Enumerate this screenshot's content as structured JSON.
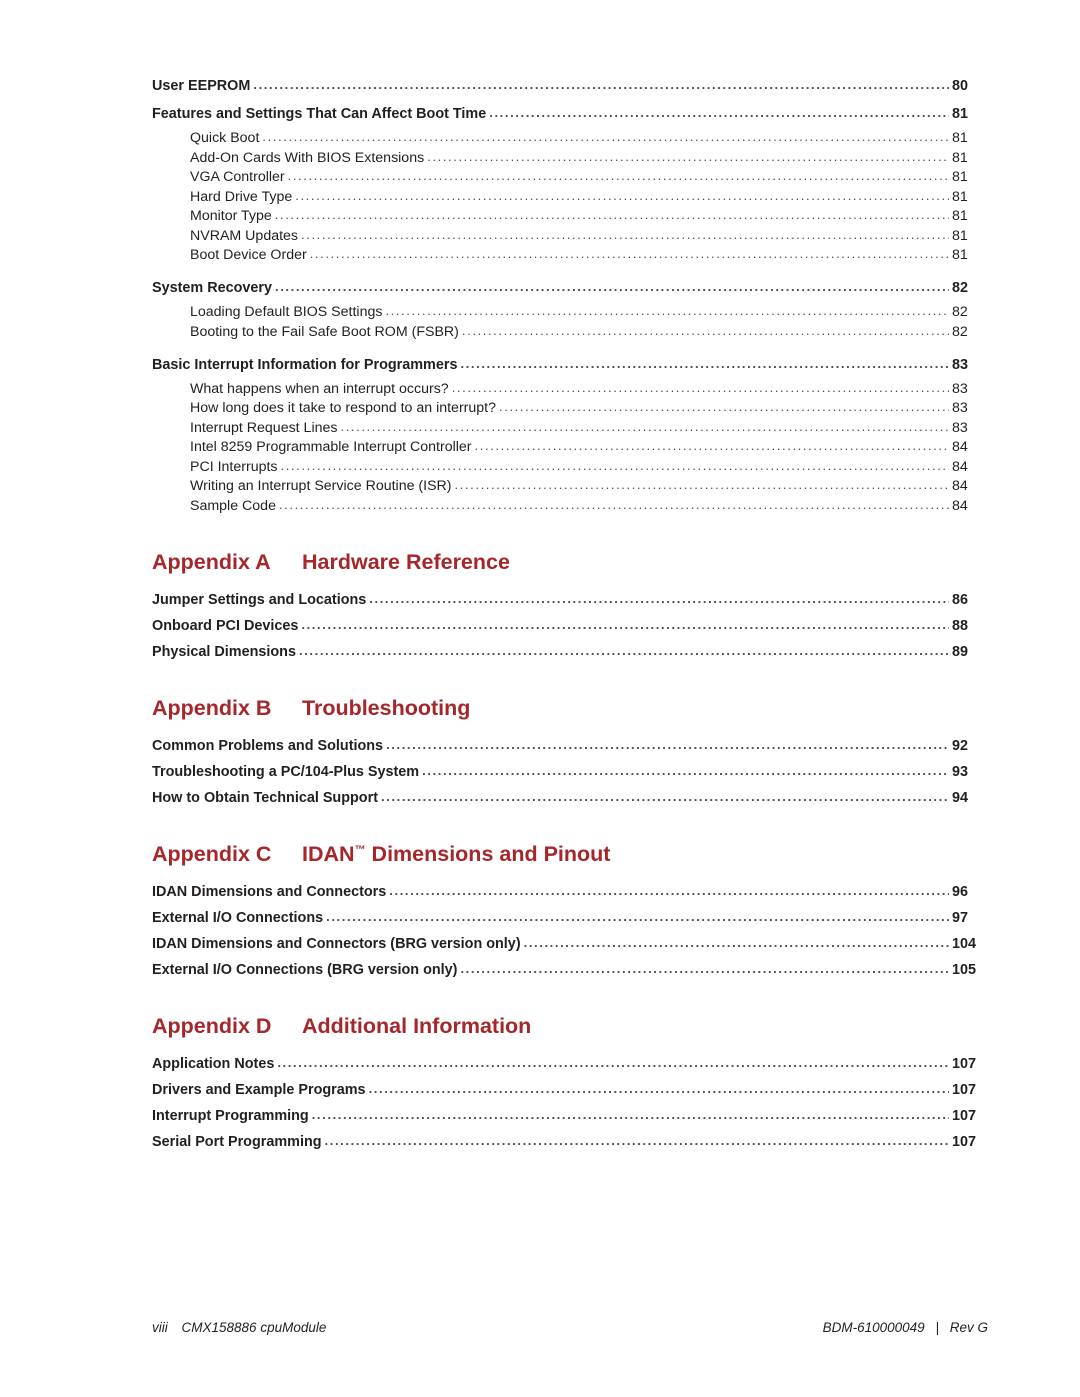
{
  "toc": {
    "sections": [
      {
        "type": "entries",
        "items": [
          {
            "level": 1,
            "label": "User EEPROM",
            "page": "80"
          },
          {
            "level": 1,
            "label": "Features and Settings That Can Affect Boot Time",
            "page": "81"
          },
          {
            "level": 2,
            "label": "Quick Boot",
            "page": "81"
          },
          {
            "level": 2,
            "label": "Add-On Cards With BIOS Extensions",
            "page": "81"
          },
          {
            "level": 2,
            "label": "VGA Controller",
            "page": "81"
          },
          {
            "level": 2,
            "label": "Hard Drive Type",
            "page": "81"
          },
          {
            "level": 2,
            "label": "Monitor Type",
            "page": "81"
          },
          {
            "level": 2,
            "label": "NVRAM Updates",
            "page": "81"
          },
          {
            "level": 2,
            "label": "Boot Device Order",
            "page": "81"
          },
          {
            "level": 1,
            "label": "System Recovery",
            "page": "82"
          },
          {
            "level": 2,
            "label": "Loading Default BIOS Settings",
            "page": "82"
          },
          {
            "level": 2,
            "label": "Booting to the Fail Safe Boot ROM (FSBR)",
            "page": "82"
          },
          {
            "level": 1,
            "label": "Basic Interrupt Information for Programmers",
            "page": "83"
          },
          {
            "level": 2,
            "label": "What happens when an interrupt occurs?",
            "page": "83"
          },
          {
            "level": 2,
            "label": "How long does it take to respond to an interrupt?",
            "page": "83"
          },
          {
            "level": 2,
            "label": "Interrupt Request Lines",
            "page": "83"
          },
          {
            "level": 2,
            "label": "Intel 8259 Programmable Interrupt Controller",
            "page": "84"
          },
          {
            "level": 2,
            "label": "PCI Interrupts",
            "page": "84"
          },
          {
            "level": 2,
            "label": "Writing an Interrupt Service Routine (ISR)",
            "page": "84"
          },
          {
            "level": 2,
            "label": "Sample Code",
            "page": "84"
          }
        ]
      }
    ],
    "appendices": [
      {
        "num": "Appendix A",
        "title": "Hardware Reference",
        "title_tm": "",
        "items": [
          {
            "level": 1,
            "label": "Jumper Settings and Locations",
            "page": "86"
          },
          {
            "level": 1,
            "label": "Onboard PCI Devices",
            "page": "88"
          },
          {
            "level": 1,
            "label": "Physical Dimensions",
            "page": "89"
          }
        ]
      },
      {
        "num": "Appendix B",
        "title": "Troubleshooting",
        "title_tm": "",
        "items": [
          {
            "level": 1,
            "label": "Common Problems and Solutions",
            "page": "92"
          },
          {
            "level": 1,
            "label": "Troubleshooting a PC/104-Plus System",
            "page": "93"
          },
          {
            "level": 1,
            "label": "How to Obtain Technical Support",
            "page": "94"
          }
        ]
      },
      {
        "num": "Appendix C",
        "title": "IDAN",
        "title_tm": "™",
        "title_rest": " Dimensions and Pinout",
        "items": [
          {
            "level": 1,
            "label": "IDAN Dimensions and Connectors",
            "page": "96"
          },
          {
            "level": 1,
            "label": "External I/O Connections",
            "page": "97"
          },
          {
            "level": 1,
            "label": "IDAN Dimensions and Connectors (BRG version only)",
            "page": "104"
          },
          {
            "level": 1,
            "label": "External I/O Connections (BRG version only)",
            "page": "105"
          }
        ]
      },
      {
        "num": "Appendix D",
        "title": "Additional Information",
        "title_tm": "",
        "items": [
          {
            "level": 1,
            "label": "Application Notes",
            "page": "107"
          },
          {
            "level": 1,
            "label": "Drivers and Example Programs",
            "page": "107"
          },
          {
            "level": 1,
            "label": "Interrupt Programming",
            "page": "107"
          },
          {
            "level": 1,
            "label": "Serial Port Programming",
            "page": "107"
          }
        ]
      }
    ]
  },
  "footer": {
    "page_number": "viii",
    "product": "CMX158886 cpuModule",
    "doc_number": "BDM-610000049",
    "separator": "|",
    "revision": "Rev G"
  },
  "colors": {
    "accent": "#a5272c",
    "text": "#231f20"
  }
}
